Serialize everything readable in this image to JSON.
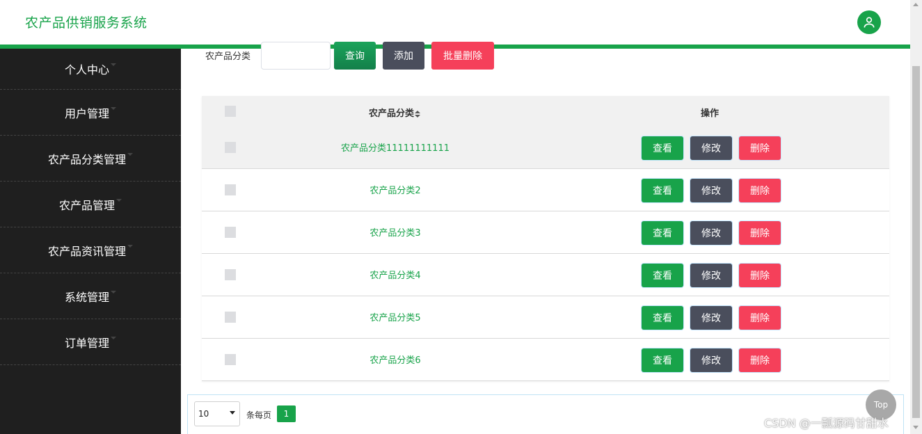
{
  "header": {
    "brand": "农产品供销服务系统",
    "accent": "#18a34a"
  },
  "sidebar": {
    "items": [
      {
        "label": "个人中心"
      },
      {
        "label": "用户管理"
      },
      {
        "label": "农产品分类管理"
      },
      {
        "label": "农产品管理"
      },
      {
        "label": "农产品资讯管理"
      },
      {
        "label": "系统管理"
      },
      {
        "label": "订单管理"
      }
    ]
  },
  "search": {
    "label": "农产品分类",
    "value": "",
    "query_label": "查询",
    "add_label": "添加",
    "batch_delete_label": "批量删除"
  },
  "table": {
    "col_category": "农产品分类",
    "col_operation": "操作",
    "rows": [
      {
        "name": "农产品分类11111111111"
      },
      {
        "name": "农产品分类2"
      },
      {
        "name": "农产品分类3"
      },
      {
        "name": "农产品分类4"
      },
      {
        "name": "农产品分类5"
      },
      {
        "name": "农产品分类6"
      }
    ],
    "view_label": "查看",
    "edit_label": "修改",
    "delete_label": "删除"
  },
  "pager": {
    "page_size": "10",
    "per_page_label": "条每页",
    "current_page": "1"
  },
  "top_button": "Top",
  "watermark": "CSDN @一瓢源码甘甜水"
}
